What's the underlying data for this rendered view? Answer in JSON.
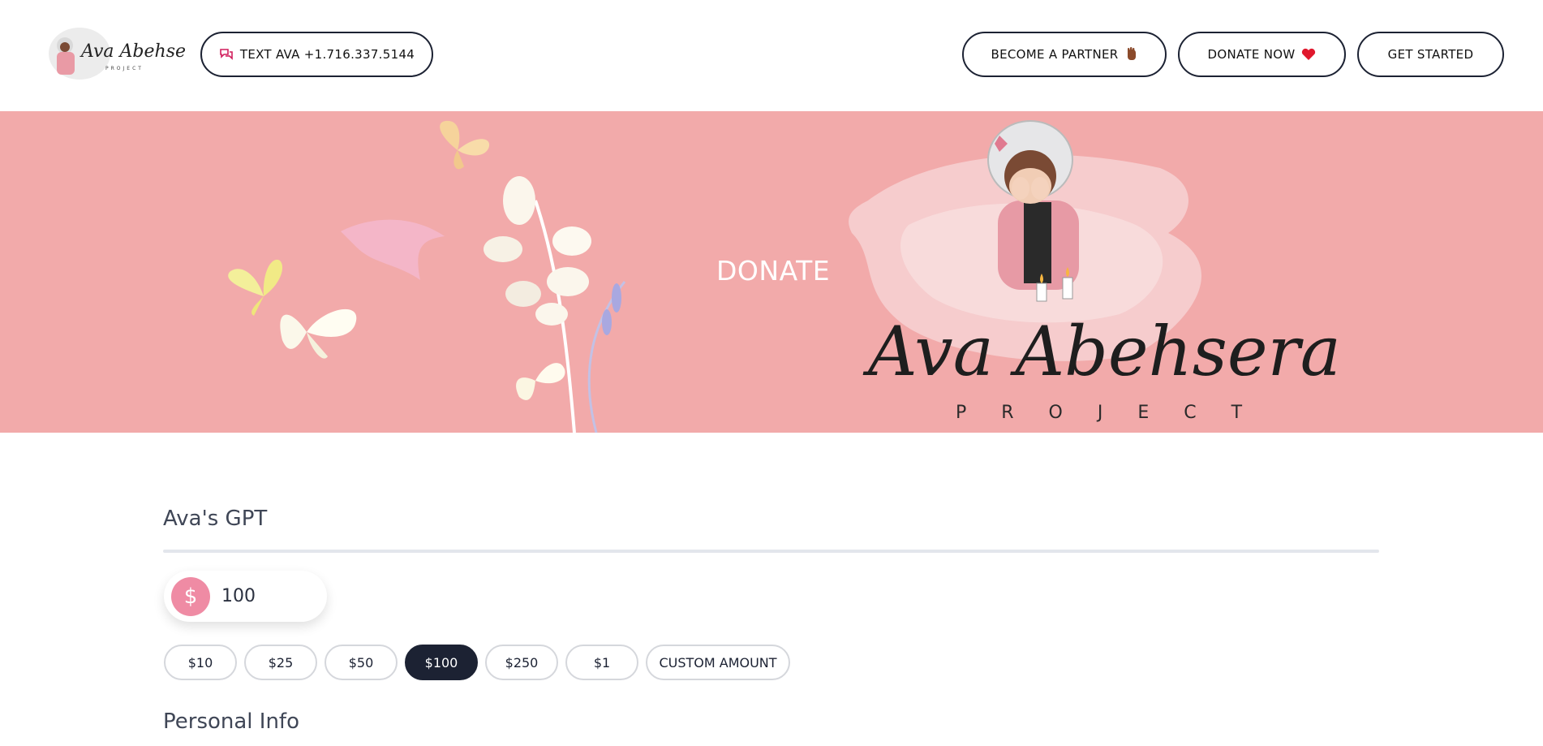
{
  "header": {
    "logo_text": "Ava Abehsera",
    "logo_subtext": "PROJECT",
    "text_button": {
      "label": "TEXT AVA +1.716.337.5144",
      "icon": "chat-icon"
    },
    "partner_button": {
      "label": "BECOME A PARTNER",
      "icon": "hand-icon"
    },
    "donate_button": {
      "label": "DONATE NOW",
      "icon": "heart-icon"
    },
    "started_button": {
      "label": "GET STARTED"
    }
  },
  "banner": {
    "title": "DONATE",
    "logo_script": "Ava Abehsera",
    "logo_sub": "P R O J E C T"
  },
  "form": {
    "section_title": "Ava's GPT",
    "currency_symbol": "$",
    "amount_value": "100",
    "amount_options": [
      "$10",
      "$25",
      "$50",
      "$100",
      "$250",
      "$1",
      "CUSTOM AMOUNT"
    ],
    "selected_amount": "$100",
    "personal_info_title": "Personal Info"
  },
  "colors": {
    "brand_dark": "#1c2233",
    "banner_pink": "#f2aaaa",
    "accent_pink": "#ef8ba4",
    "heart_red": "#e0182d"
  }
}
